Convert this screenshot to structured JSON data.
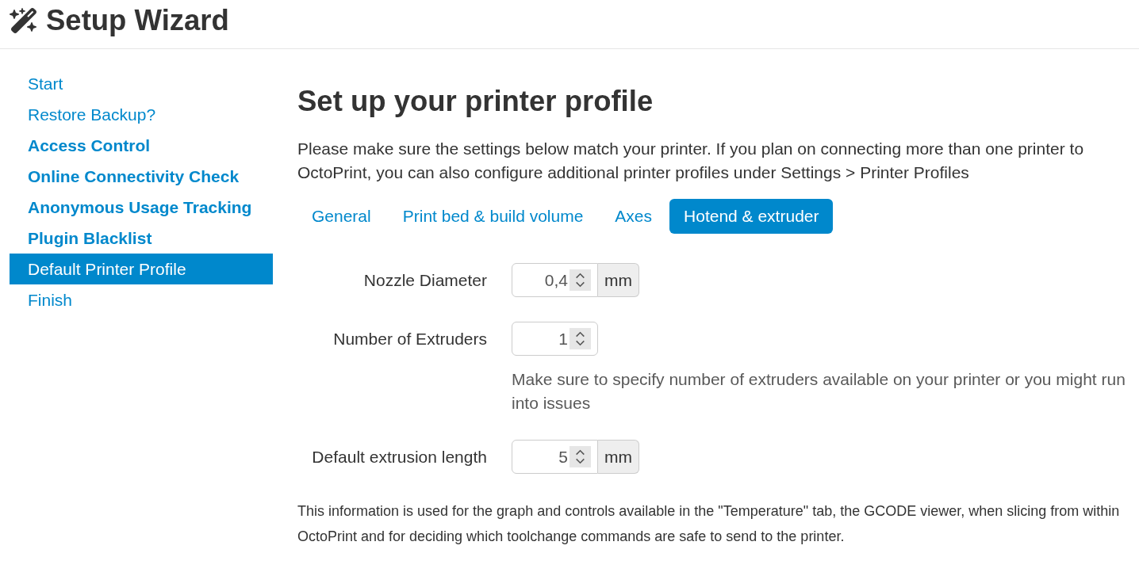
{
  "header": {
    "title": "Setup Wizard"
  },
  "sidebar": {
    "items": [
      {
        "label": "Start",
        "required": false,
        "selected": false
      },
      {
        "label": "Restore Backup?",
        "required": false,
        "selected": false
      },
      {
        "label": "Access Control",
        "required": true,
        "selected": false
      },
      {
        "label": "Online Connectivity Check",
        "required": true,
        "selected": false
      },
      {
        "label": "Anonymous Usage Tracking",
        "required": true,
        "selected": false
      },
      {
        "label": "Plugin Blacklist",
        "required": true,
        "selected": false
      },
      {
        "label": "Default Printer Profile",
        "required": false,
        "selected": true
      },
      {
        "label": "Finish",
        "required": false,
        "selected": false
      }
    ]
  },
  "main": {
    "title": "Set up your printer profile",
    "intro": "Please make sure the settings below match your printer. If you plan on connecting more than one printer to OctoPrint, you can also configure additional printer profiles under Settings > Printer Profiles",
    "tabs": [
      {
        "label": "General",
        "selected": false
      },
      {
        "label": "Print bed & build volume",
        "selected": false
      },
      {
        "label": "Axes",
        "selected": false
      },
      {
        "label": "Hotend & extruder",
        "selected": true
      }
    ],
    "fields": [
      {
        "label": "Nozzle Diameter",
        "value": "0,4",
        "unit": "mm"
      },
      {
        "label": "Number of Extruders",
        "value": "1",
        "help": "Make sure to specify number of extruders available on your printer or you might run into issues"
      },
      {
        "label": "Default extrusion length",
        "value": "5",
        "unit": "mm"
      }
    ],
    "note": "This information is used for the graph and controls available in the \"Temperature\" tab, the GCODE viewer, when slicing from within OctoPrint and for deciding which toolchange commands are safe to send to the printer."
  }
}
